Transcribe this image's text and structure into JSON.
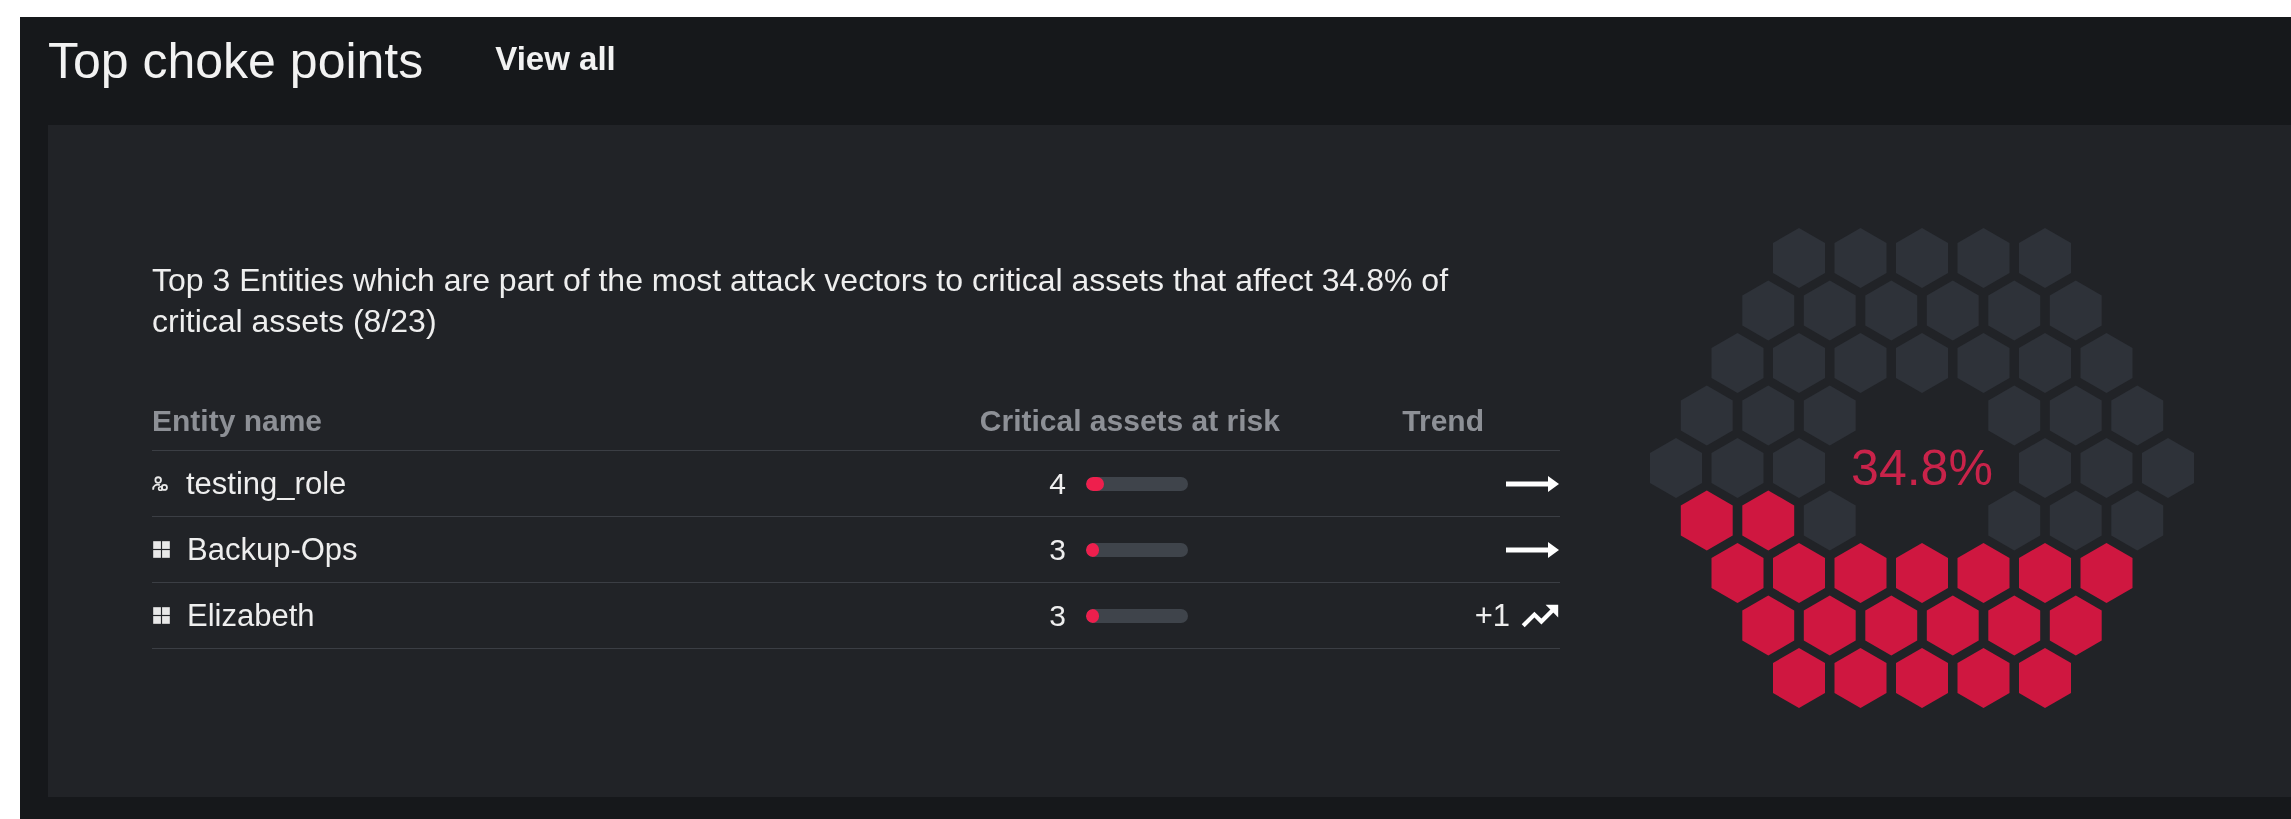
{
  "header": {
    "title": "Top choke points",
    "link": "View all"
  },
  "card": {
    "description": "Top 3 Entities which are part of the most attack vectors to critical assets that affect 34.8% of critical assets (8/23)",
    "columns": [
      "Entity name",
      "Critical assets at risk",
      "Trend"
    ],
    "rows": [
      {
        "kind": "role",
        "name": "testing_role",
        "count": "4",
        "level": 0.18,
        "trend": {
          "kind": "flat"
        }
      },
      {
        "kind": "group",
        "name": "Backup-Ops",
        "count": "3",
        "level": 0.13,
        "trend": {
          "kind": "flat"
        }
      },
      {
        "kind": "group",
        "name": "Elizabeth",
        "count": "3",
        "level": 0.13,
        "trend": {
          "kind": "up",
          "delta": "+1"
        }
      }
    ],
    "coverage": {
      "label": "34.8%",
      "hexagons": [
        {
          "filled": false
        },
        {
          "filled": false
        },
        {
          "filled": false
        },
        {
          "filled": false
        },
        {
          "filled": false
        },
        {
          "filled": false
        },
        {
          "filled": false
        },
        {
          "filled": false
        },
        {
          "filled": false
        },
        {
          "filled": false
        },
        {
          "filled": false
        },
        {
          "filled": false
        },
        {
          "filled": false
        },
        {
          "filled": false
        },
        {
          "filled": false
        },
        {
          "filled": false
        },
        {
          "filled": false
        },
        {
          "filled": false
        },
        {
          "filled": false
        },
        {
          "filled": false
        },
        {
          "filled": false
        },
        {
          "filled": false
        },
        {
          "filled": false
        },
        {
          "filled": false
        },
        {
          "filled": false
        },
        {
          "filled": false
        },
        {
          "filled": false
        },
        {
          "filled": false
        },
        {
          "filled": false
        },
        {
          "filled": false
        },
        {
          "filled": true
        },
        {
          "filled": true
        },
        {
          "filled": false
        },
        {
          "filled": false
        },
        {
          "filled": false
        },
        {
          "filled": false
        },
        {
          "filled": true
        },
        {
          "filled": true
        },
        {
          "filled": true
        },
        {
          "filled": true
        },
        {
          "filled": true
        },
        {
          "filled": true
        },
        {
          "filled": true
        },
        {
          "filled": true
        },
        {
          "filled": true
        },
        {
          "filled": true
        },
        {
          "filled": true
        },
        {
          "filled": true
        },
        {
          "filled": true
        },
        {
          "filled": true
        },
        {
          "filled": true
        },
        {
          "filled": true
        },
        {
          "filled": true
        },
        {
          "filled": true
        }
      ]
    }
  }
}
